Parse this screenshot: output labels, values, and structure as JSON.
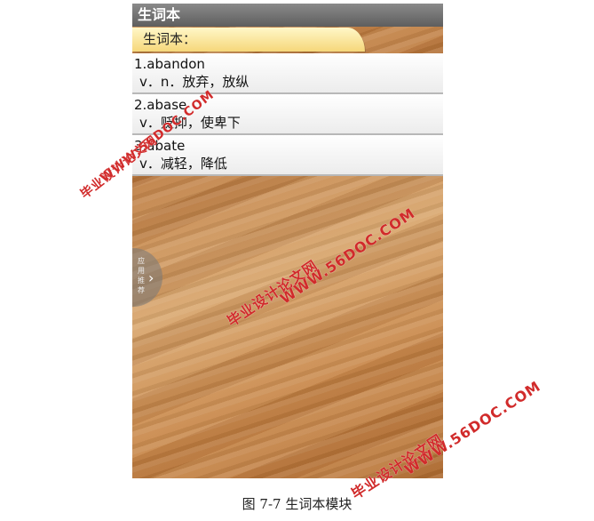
{
  "app": {
    "title": "生词本"
  },
  "tab": {
    "label": "生词本："
  },
  "words": [
    {
      "word": "1.abandon",
      "meaning": "v．n．放弃，放纵"
    },
    {
      "word": "2.abase",
      "meaning": "v．贬抑，使卑下"
    },
    {
      "word": "3.abate",
      "meaning": "v．减轻，降低"
    }
  ],
  "side_button": {
    "label": "应用推荐",
    "icon": "chevron-right-icon"
  },
  "watermarks": {
    "site_name": "毕业设计论文网",
    "url": "WWW.56DOC.COM"
  },
  "caption": "图 7-7  生词本模块",
  "colors": {
    "watermark": "#d12b2b",
    "tab": "#f6d77a",
    "titlebar": "#6e6e6e"
  }
}
